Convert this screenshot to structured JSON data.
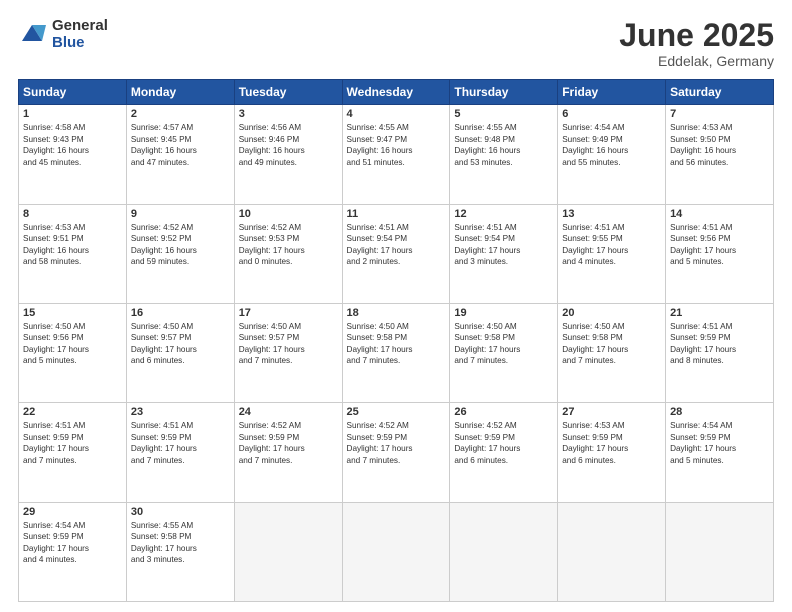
{
  "logo": {
    "general": "General",
    "blue": "Blue"
  },
  "title": {
    "month": "June 2025",
    "location": "Eddelak, Germany"
  },
  "weekdays": [
    "Sunday",
    "Monday",
    "Tuesday",
    "Wednesday",
    "Thursday",
    "Friday",
    "Saturday"
  ],
  "weeks": [
    [
      {
        "day": "1",
        "info": "Sunrise: 4:58 AM\nSunset: 9:43 PM\nDaylight: 16 hours\nand 45 minutes."
      },
      {
        "day": "2",
        "info": "Sunrise: 4:57 AM\nSunset: 9:45 PM\nDaylight: 16 hours\nand 47 minutes."
      },
      {
        "day": "3",
        "info": "Sunrise: 4:56 AM\nSunset: 9:46 PM\nDaylight: 16 hours\nand 49 minutes."
      },
      {
        "day": "4",
        "info": "Sunrise: 4:55 AM\nSunset: 9:47 PM\nDaylight: 16 hours\nand 51 minutes."
      },
      {
        "day": "5",
        "info": "Sunrise: 4:55 AM\nSunset: 9:48 PM\nDaylight: 16 hours\nand 53 minutes."
      },
      {
        "day": "6",
        "info": "Sunrise: 4:54 AM\nSunset: 9:49 PM\nDaylight: 16 hours\nand 55 minutes."
      },
      {
        "day": "7",
        "info": "Sunrise: 4:53 AM\nSunset: 9:50 PM\nDaylight: 16 hours\nand 56 minutes."
      }
    ],
    [
      {
        "day": "8",
        "info": "Sunrise: 4:53 AM\nSunset: 9:51 PM\nDaylight: 16 hours\nand 58 minutes."
      },
      {
        "day": "9",
        "info": "Sunrise: 4:52 AM\nSunset: 9:52 PM\nDaylight: 16 hours\nand 59 minutes."
      },
      {
        "day": "10",
        "info": "Sunrise: 4:52 AM\nSunset: 9:53 PM\nDaylight: 17 hours\nand 0 minutes."
      },
      {
        "day": "11",
        "info": "Sunrise: 4:51 AM\nSunset: 9:54 PM\nDaylight: 17 hours\nand 2 minutes."
      },
      {
        "day": "12",
        "info": "Sunrise: 4:51 AM\nSunset: 9:54 PM\nDaylight: 17 hours\nand 3 minutes."
      },
      {
        "day": "13",
        "info": "Sunrise: 4:51 AM\nSunset: 9:55 PM\nDaylight: 17 hours\nand 4 minutes."
      },
      {
        "day": "14",
        "info": "Sunrise: 4:51 AM\nSunset: 9:56 PM\nDaylight: 17 hours\nand 5 minutes."
      }
    ],
    [
      {
        "day": "15",
        "info": "Sunrise: 4:50 AM\nSunset: 9:56 PM\nDaylight: 17 hours\nand 5 minutes."
      },
      {
        "day": "16",
        "info": "Sunrise: 4:50 AM\nSunset: 9:57 PM\nDaylight: 17 hours\nand 6 minutes."
      },
      {
        "day": "17",
        "info": "Sunrise: 4:50 AM\nSunset: 9:57 PM\nDaylight: 17 hours\nand 7 minutes."
      },
      {
        "day": "18",
        "info": "Sunrise: 4:50 AM\nSunset: 9:58 PM\nDaylight: 17 hours\nand 7 minutes."
      },
      {
        "day": "19",
        "info": "Sunrise: 4:50 AM\nSunset: 9:58 PM\nDaylight: 17 hours\nand 7 minutes."
      },
      {
        "day": "20",
        "info": "Sunrise: 4:50 AM\nSunset: 9:58 PM\nDaylight: 17 hours\nand 7 minutes."
      },
      {
        "day": "21",
        "info": "Sunrise: 4:51 AM\nSunset: 9:59 PM\nDaylight: 17 hours\nand 8 minutes."
      }
    ],
    [
      {
        "day": "22",
        "info": "Sunrise: 4:51 AM\nSunset: 9:59 PM\nDaylight: 17 hours\nand 7 minutes."
      },
      {
        "day": "23",
        "info": "Sunrise: 4:51 AM\nSunset: 9:59 PM\nDaylight: 17 hours\nand 7 minutes."
      },
      {
        "day": "24",
        "info": "Sunrise: 4:52 AM\nSunset: 9:59 PM\nDaylight: 17 hours\nand 7 minutes."
      },
      {
        "day": "25",
        "info": "Sunrise: 4:52 AM\nSunset: 9:59 PM\nDaylight: 17 hours\nand 7 minutes."
      },
      {
        "day": "26",
        "info": "Sunrise: 4:52 AM\nSunset: 9:59 PM\nDaylight: 17 hours\nand 6 minutes."
      },
      {
        "day": "27",
        "info": "Sunrise: 4:53 AM\nSunset: 9:59 PM\nDaylight: 17 hours\nand 6 minutes."
      },
      {
        "day": "28",
        "info": "Sunrise: 4:54 AM\nSunset: 9:59 PM\nDaylight: 17 hours\nand 5 minutes."
      }
    ],
    [
      {
        "day": "29",
        "info": "Sunrise: 4:54 AM\nSunset: 9:59 PM\nDaylight: 17 hours\nand 4 minutes."
      },
      {
        "day": "30",
        "info": "Sunrise: 4:55 AM\nSunset: 9:58 PM\nDaylight: 17 hours\nand 3 minutes."
      },
      {
        "day": "",
        "info": ""
      },
      {
        "day": "",
        "info": ""
      },
      {
        "day": "",
        "info": ""
      },
      {
        "day": "",
        "info": ""
      },
      {
        "day": "",
        "info": ""
      }
    ]
  ]
}
